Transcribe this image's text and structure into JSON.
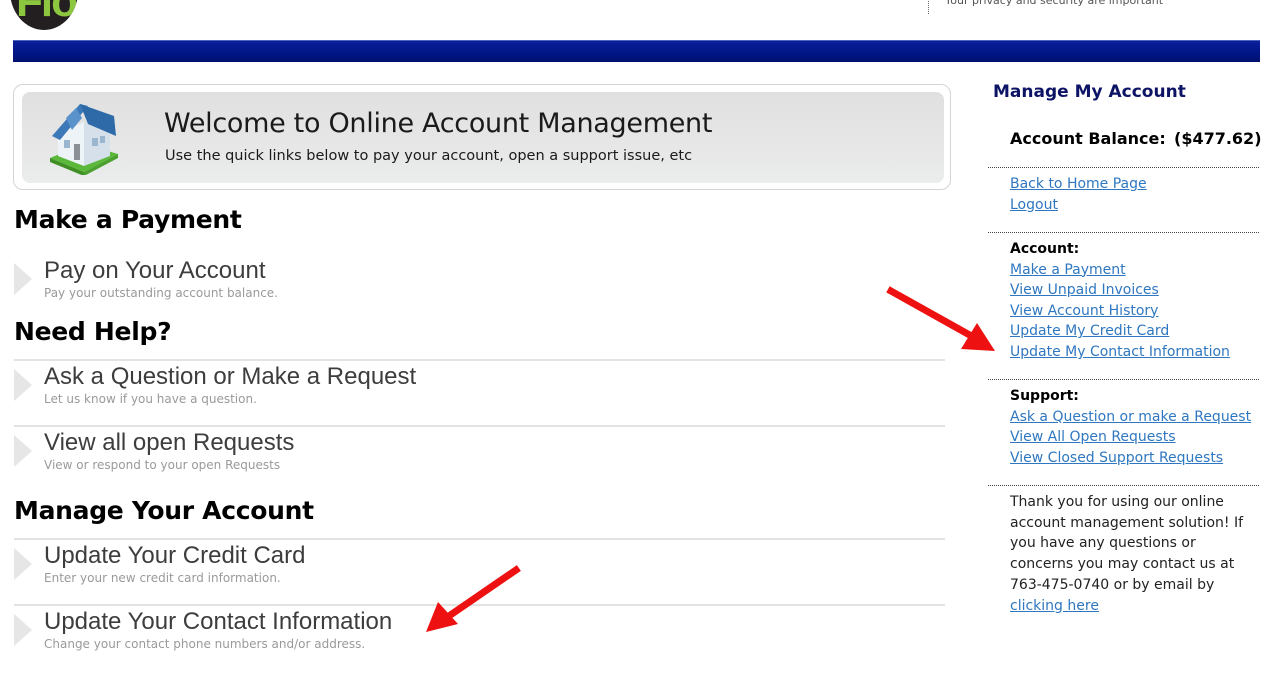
{
  "header": {
    "logo_text": "Flo",
    "tagline": "Your privacy and security are important"
  },
  "welcome": {
    "icon": "house-icon",
    "title": "Welcome to Online Account Management",
    "subtitle": "Use the quick links below to pay your account, open a support issue, etc"
  },
  "sections": [
    {
      "title": "Make a Payment",
      "links": [
        {
          "title": "Pay on Your Account",
          "description": "Pay your outstanding account balance."
        }
      ]
    },
    {
      "title": "Need Help?",
      "links": [
        {
          "title": "Ask a Question or Make a Request",
          "description": "Let us know if you have a question."
        },
        {
          "title": "View all open Requests",
          "description": "View or respond to your open Requests"
        }
      ]
    },
    {
      "title": "Manage Your Account",
      "links": [
        {
          "title": "Update Your Credit Card",
          "description": "Enter your new credit card information."
        },
        {
          "title": "Update Your Contact Information",
          "description": "Change your contact phone numbers and/or address."
        }
      ]
    }
  ],
  "sidebar": {
    "title": "Manage My Account",
    "balance_label": "Account Balance:",
    "balance_value": "($477.62)",
    "nav_links": [
      "Back to Home Page",
      "Logout"
    ],
    "account": {
      "heading": "Account:",
      "links": [
        "Make a Payment",
        "View Unpaid Invoices",
        "View Account History",
        "Update My Credit Card",
        "Update My Contact Information"
      ]
    },
    "support": {
      "heading": "Support:",
      "links": [
        "Ask a Question or make a Request",
        "View All Open Requests",
        "View Closed Support Requests"
      ]
    },
    "footer_text": "Thank you for using our online account management solution! If you have any questions or concerns you may contact us at 763-475-0740 or by email by ",
    "footer_link": "clicking here"
  },
  "annotations": {
    "arrow_color": "#ee1111",
    "arrows": [
      "arrow-to-sidebar-update-contact",
      "arrow-to-update-contact-info"
    ]
  },
  "colors": {
    "header_bar": "#001585",
    "link": "#2f77c0",
    "sidebar_title": "#0d1466"
  }
}
